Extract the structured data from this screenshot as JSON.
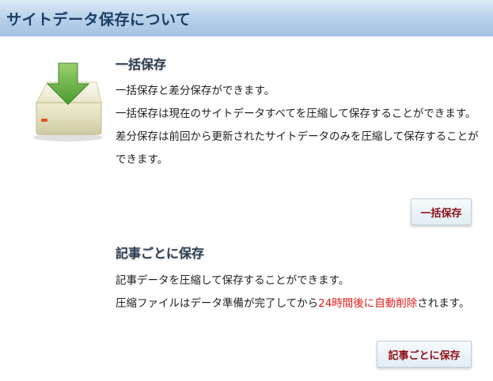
{
  "header": {
    "title": "サイトデータ保存について"
  },
  "bulk": {
    "icon": "hard-drive-download-icon",
    "title": "一括保存",
    "lines": [
      "一括保存と差分保存ができます。",
      "一括保存は現在のサイトデータすべてを圧縮して保存することができます。",
      "差分保存は前回から更新されたサイトデータのみを圧縮して保存することができます。"
    ],
    "button_label": "一括保存"
  },
  "per_article": {
    "title": "記事ごとに保存",
    "line1": "記事データを圧縮して保存することができます。",
    "line2_before": "圧縮ファイルはデータ準備が完了してから",
    "line2_highlight": "24時間後に自動削除",
    "line2_after": "されます。",
    "button_label": "記事ごとに保存"
  },
  "colors": {
    "header_text": "#1b3e66",
    "highlight": "#e01b1b",
    "button_text": "#8e0e16"
  }
}
